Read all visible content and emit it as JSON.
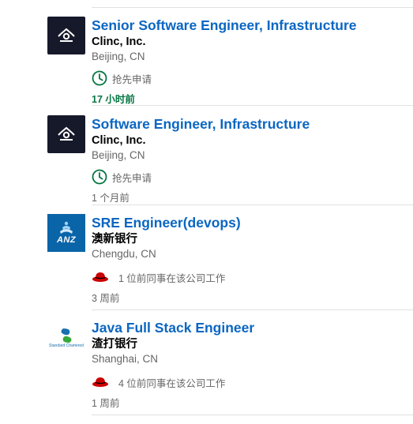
{
  "jobs": [
    {
      "title": "Senior Software Engineer, Infrastructure",
      "company": "Clinc, Inc.",
      "location": "Beijing, CN",
      "insight": "抢先申请",
      "posted": "17 小时前"
    },
    {
      "title": "Software Engineer, Infrastructure",
      "company": "Clinc, Inc.",
      "location": "Beijing, CN",
      "insight": "抢先申请",
      "posted": "1 个月前"
    },
    {
      "title": "SRE Engineer(devops)",
      "company": "澳新银行",
      "location": "Chengdu, CN",
      "insight": "1 位前同事在该公司工作",
      "posted": "3 周前",
      "logo_text": "ANZ"
    },
    {
      "title": "Java Full Stack Engineer",
      "company": "渣打银行",
      "location": "Shanghai, CN",
      "insight": "4 位前同事在该公司工作",
      "posted": "1 周前",
      "logo_text": "Standard Chartered"
    }
  ],
  "colors": {
    "title": "#0a66c2",
    "fresh": "#057642",
    "clinc_bg": "#16192a",
    "anz_bg": "#0a64a8",
    "hat": "#cc0000"
  }
}
